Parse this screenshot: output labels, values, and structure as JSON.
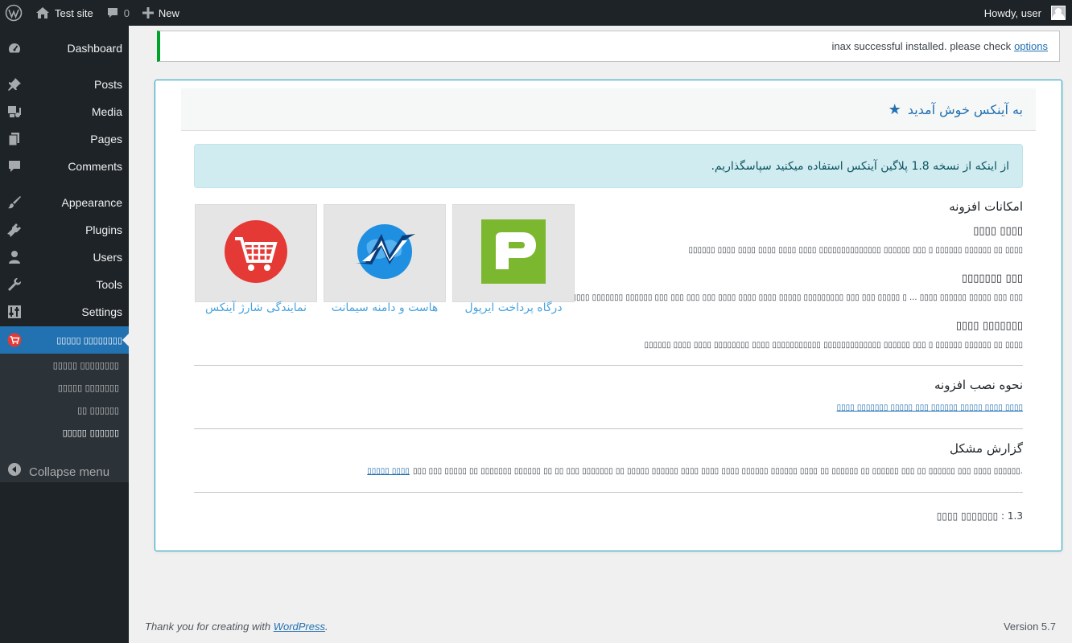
{
  "admin_bar": {
    "site_name": "Test site",
    "comments_count": "0",
    "new_label": "New",
    "howdy": "Howdy, user"
  },
  "sidebar": {
    "items": [
      {
        "label": "Dashboard",
        "icon": "dashboard-icon"
      },
      {
        "label": "Posts",
        "icon": "pin-icon"
      },
      {
        "label": "Media",
        "icon": "media-icon"
      },
      {
        "label": "Pages",
        "icon": "pages-icon"
      },
      {
        "label": "Comments",
        "icon": "comment-icon"
      },
      {
        "label": "Appearance",
        "icon": "brush-icon"
      },
      {
        "label": "Plugins",
        "icon": "plugin-icon"
      },
      {
        "label": "Users",
        "icon": "user-icon"
      },
      {
        "label": "Tools",
        "icon": "wrench-icon"
      },
      {
        "label": "Settings",
        "icon": "settings-icon"
      },
      {
        "label": "▯▯▯▯▯ ▯▯▯▯▯▯▯▯",
        "icon": "cart-icon"
      }
    ],
    "submenu": [
      "▯▯▯▯▯ ▯▯▯▯▯▯▯▯",
      "▯▯▯▯▯ ▯▯▯▯▯▯▯",
      "▯▯ ▯▯▯▯▯▯",
      "▯▯▯▯▯ ▯▯▯▯▯▯"
    ],
    "collapse_label": "Collapse menu"
  },
  "notice": {
    "text": "inax successful installed. please check",
    "link": "options"
  },
  "panel": {
    "title": "به آینکس خوش آمدید",
    "thanks": ".از اینکه از نسخه 1.8 پلاگین آینکس استفاده میکنید سپاسگذاریم",
    "features_title": "امکانات افزونه",
    "features": [
      {
        "title": "▯▯▯▯ ▯▯▯▯",
        "desc": "▯▯▯▯▯▯ ▯▯▯▯ ▯▯▯▯ ▯▯▯▯ ▯▯▯▯ ▯▯▯▯ ▯▯▯▯▯▯▯▯▯▯▯▯▯▯ ▯▯▯▯▯▯ ▯▯▯ ▯ ▯▯▯▯▯▯ ▯▯▯▯▯▯ ▯▯ ▯▯▯▯"
      },
      {
        "title": "▯▯▯▯▯▯▯ ▯▯▯",
        "desc": "▯▯▯▯▯▯ ▯▯▯▯▯▯▯ ▯▯▯▯▯▯ ▯▯▯ ▯▯▯ ▯▯▯ ▯▯▯ ▯▯▯▯ ▯▯▯▯ ▯▯▯▯ ▯▯▯▯▯ ▯▯▯▯▯▯▯▯▯ ▯▯▯ ▯▯▯ ▯▯▯▯▯ ▯ ... ▯▯▯▯ ▯▯▯▯▯▯ ▯▯▯▯▯ ▯▯▯ ▯▯▯"
      },
      {
        "title": "▯▯▯▯ ▯▯▯▯▯▯▯",
        "desc": "▯▯▯▯▯▯ ▯▯▯▯ ▯▯▯▯ ▯▯▯▯▯▯▯▯ ▯▯▯▯ ▯▯▯▯▯▯▯▯▯▯▯ ▯▯▯▯▯▯▯▯▯▯▯▯▯ ▯▯▯▯▯▯ ▯▯▯ ▯ ▯▯▯▯▯▯ ▯▯▯▯▯▯ ▯▯ ▯▯▯▯"
      }
    ],
    "products": [
      {
        "label": "درگاه پرداخت ایرپول",
        "icon": "irpool-logo-icon",
        "color": "#7cb82f"
      },
      {
        "label": "هاست و دامنه سیمانت",
        "icon": "simanet-globe-icon",
        "color": "#1e8fe1"
      },
      {
        "label": "نمایندگی شارژ آینکس",
        "icon": "cart-logo-icon",
        "color": "#e53935"
      }
    ],
    "install_title": "نحوه نصب افزونه",
    "install_link": "▯▯▯▯ ▯▯▯▯▯▯▯ ▯▯▯▯▯ ▯▯▯ ▯▯▯▯▯▯ ▯▯▯▯▯ ▯▯▯▯ ▯▯▯▯",
    "report_title": "گزارش مشکل",
    "report_text": "▯▯▯ ▯▯▯ ▯▯▯▯▯ ▯▯ ▯▯▯▯▯▯▯ ▯▯▯▯▯▯ ▯▯ ▯▯ ▯▯▯ ▯▯▯▯▯▯▯ ▯▯ ▯▯▯▯▯ ▯▯▯▯▯▯ ▯▯▯▯ ▯▯▯▯ ▯▯▯▯ ▯▯▯▯▯▯ ▯▯▯▯▯▯ ▯▯▯▯ ▯▯ ▯▯▯▯▯▯ ▯▯ ▯▯▯▯▯▯ ▯▯▯ ▯▯ ▯▯▯▯▯▯ ▯▯▯ ▯▯▯▯ ▯▯▯▯▯▯.",
    "report_link": "▯▯▯▯▯ ▯▯▯▯",
    "version_line": "▯▯▯▯ ▯▯▯▯▯▯▯ : 1.3"
  },
  "footer": {
    "thanks": "Thank you for creating with",
    "link": "WordPress",
    "version": "Version 5.7"
  },
  "colors": {
    "accent": "#2271b1",
    "notice_success": "#00a32a",
    "panel_border": "#17a2b8",
    "info_bg": "#d1ecf1"
  }
}
